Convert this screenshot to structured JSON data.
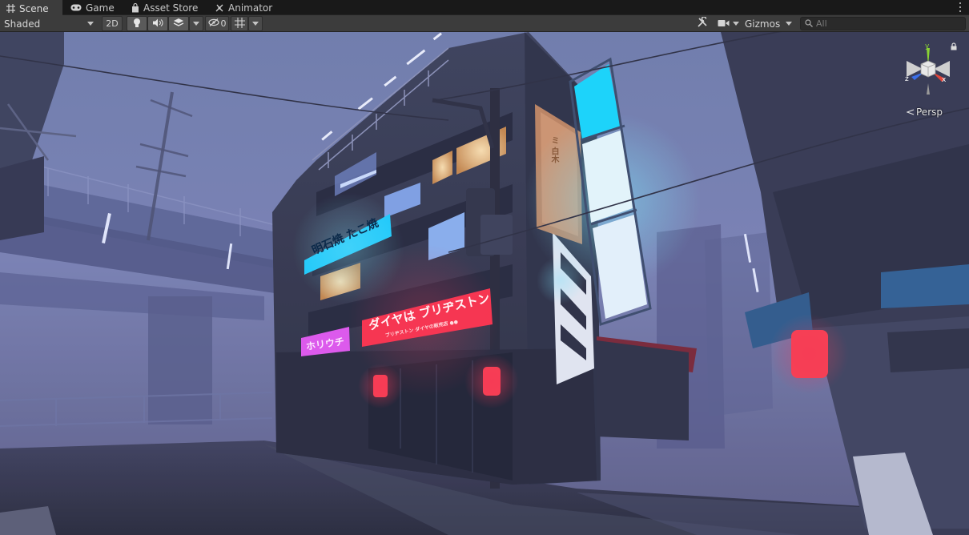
{
  "tabs": [
    {
      "label": "Scene",
      "icon": "grid-icon",
      "active": true
    },
    {
      "label": "Game",
      "icon": "gamepad-icon",
      "active": false
    },
    {
      "label": "Asset Store",
      "icon": "shopping-bag-icon",
      "active": false
    },
    {
      "label": "Animator",
      "icon": "animator-icon",
      "active": false
    }
  ],
  "toolbar": {
    "shading_mode": "Shaded",
    "mode_2d_label": "2D",
    "hidden_count": "0",
    "gizmos_label": "Gizmos",
    "search_placeholder": "All"
  },
  "viewport": {
    "projection_label": "Persp",
    "axis_labels": {
      "x": "x",
      "y": "y",
      "z": "z"
    },
    "signs": {
      "cyan_sign": "明石焼 たこ焼",
      "red_sign": "ダイヤは ブリヂストン",
      "red_sign_sub": "ブリヂストン ダイヤの販売店 ●●",
      "pink_sign": "ホリウチ",
      "orange_sign": "ミ 白木"
    }
  },
  "colors": {
    "tab_active": "#3c3c3c",
    "toolbar_bg": "#3c3c3c",
    "neon_cyan": "#19d4ff",
    "neon_red": "#ff2a45",
    "neon_pink": "#e94cf0",
    "axis_x": "#e0453b",
    "axis_y": "#8ad334",
    "axis_z": "#3a6ee8"
  }
}
